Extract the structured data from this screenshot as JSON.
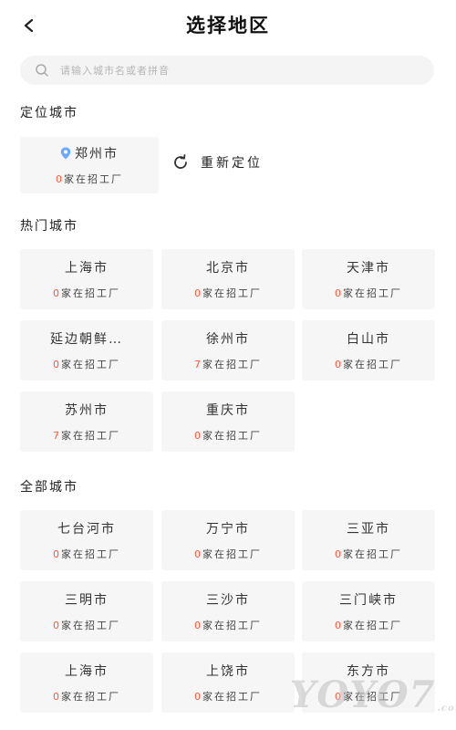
{
  "header": {
    "title": "选择地区",
    "back_icon": "chevron-left-icon"
  },
  "search": {
    "placeholder": "请输入城市名或者拼音"
  },
  "location": {
    "section_title": "定位城市",
    "city": "郑州市",
    "count": "0",
    "count_suffix": "家在招工厂",
    "relocate_label": "重新定位",
    "pin_color": "#6aa8ff"
  },
  "hot": {
    "section_title": "热门城市",
    "cities": [
      {
        "name": "上海市",
        "count": "0",
        "suffix": "家在招工厂"
      },
      {
        "name": "北京市",
        "count": "0",
        "suffix": "家在招工厂"
      },
      {
        "name": "天津市",
        "count": "0",
        "suffix": "家在招工厂"
      },
      {
        "name": "延边朝鲜…",
        "count": "0",
        "suffix": "家在招工厂"
      },
      {
        "name": "徐州市",
        "count": "7",
        "suffix": "家在招工厂"
      },
      {
        "name": "白山市",
        "count": "0",
        "suffix": "家在招工厂"
      },
      {
        "name": "苏州市",
        "count": "7",
        "suffix": "家在招工厂"
      },
      {
        "name": "重庆市",
        "count": "0",
        "suffix": "家在招工厂"
      }
    ]
  },
  "all": {
    "section_title": "全部城市",
    "cities": [
      {
        "name": "七台河市",
        "count": "0",
        "suffix": "家在招工厂"
      },
      {
        "name": "万宁市",
        "count": "0",
        "suffix": "家在招工厂"
      },
      {
        "name": "三亚市",
        "count": "0",
        "suffix": "家在招工厂"
      },
      {
        "name": "三明市",
        "count": "0",
        "suffix": "家在招工厂"
      },
      {
        "name": "三沙市",
        "count": "0",
        "suffix": "家在招工厂"
      },
      {
        "name": "三门峡市",
        "count": "0",
        "suffix": "家在招工厂"
      },
      {
        "name": "上海市",
        "count": "0",
        "suffix": "家在招工厂"
      },
      {
        "name": "上饶市",
        "count": "0",
        "suffix": "家在招工厂"
      },
      {
        "name": "东方市",
        "count": "0",
        "suffix": "家在招工厂"
      }
    ]
  },
  "watermark": {
    "text": "YOYO7",
    "suffix": ".com"
  },
  "colors": {
    "count_accent": "#ff5a3c",
    "card_bg": "#f6f6f6",
    "search_bg": "#f4f4f4"
  }
}
